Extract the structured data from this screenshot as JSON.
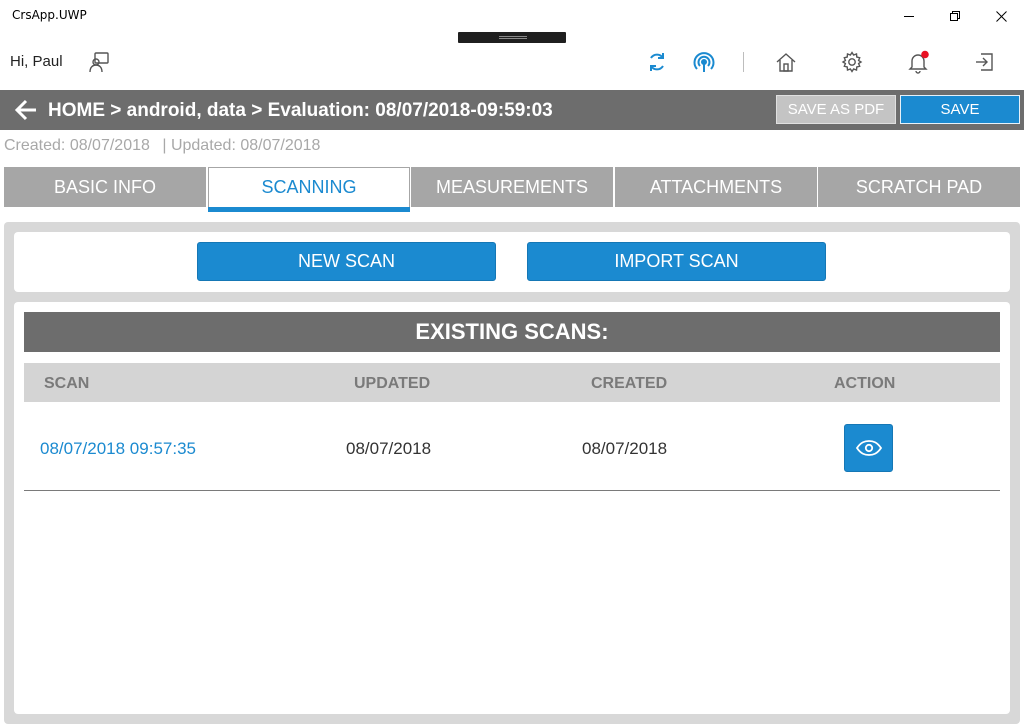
{
  "window": {
    "title": "CrsApp.UWP",
    "minimize_icon": "minimize-icon",
    "restore_icon": "restore-icon",
    "close_icon": "close-icon"
  },
  "header": {
    "greeting": "Hi, Paul",
    "icons": [
      "feedback-icon",
      "sync-icon",
      "wireless-icon",
      "home-icon",
      "gear-icon",
      "bell-icon",
      "sign-out-icon"
    ],
    "notification_dot_color": "#e81123",
    "accent_color": "#1b8ad0"
  },
  "breadcrumb": {
    "text": "HOME > android, data > Evaluation: 08/07/2018-09:59:03",
    "save_pdf_label": "SAVE AS PDF",
    "save_label": "SAVE"
  },
  "meta": {
    "created": "Created: 08/07/2018",
    "updated": "| Updated: 08/07/2018"
  },
  "tabs": [
    {
      "label": "BASIC INFO",
      "active": false
    },
    {
      "label": "SCANNING",
      "active": true
    },
    {
      "label": "MEASUREMENTS",
      "active": false
    },
    {
      "label": "ATTACHMENTS",
      "active": false
    },
    {
      "label": "SCRATCH PAD",
      "active": false
    }
  ],
  "scanning": {
    "new_scan_label": "NEW SCAN",
    "import_scan_label": "IMPORT SCAN",
    "list_title": "EXISTING SCANS:",
    "columns": [
      "SCAN",
      "UPDATED",
      "CREATED",
      "ACTION"
    ],
    "rows": [
      {
        "scan": "08/07/2018 09:57:35",
        "updated": "08/07/2018",
        "created": "08/07/2018",
        "action_icon": "eye-icon"
      }
    ]
  }
}
